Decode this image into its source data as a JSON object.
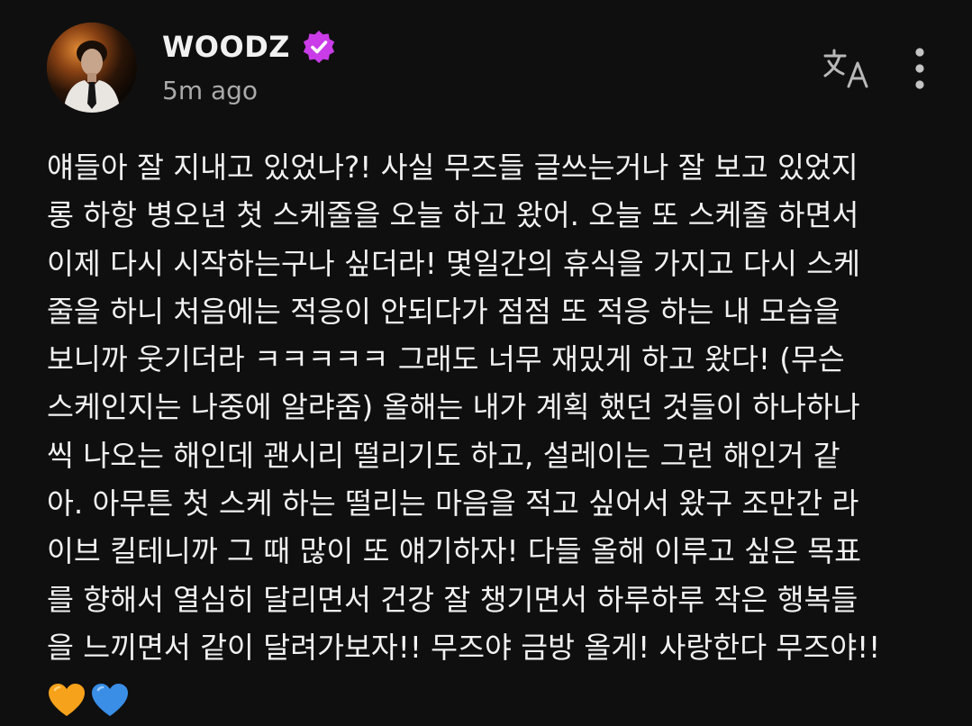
{
  "post": {
    "author": "WOODZ",
    "timestamp": "5m ago",
    "lines": [
      "얘들아 잘 지내고 있었나?! 사실 무즈들 글쓰는거나 잘 보고 있었지",
      "롱 하항 병오년 첫 스케줄을 오늘 하고 왔어. 오늘 또 스케줄 하면서",
      "이제 다시 시작하는구나 싶더라! 몇일간의 휴식을 가지고 다시 스케",
      "줄을 하니 처음에는 적응이 안되다가 점점 또 적응 하는 내 모습을",
      "보니까 웃기더라 ㅋㅋㅋㅋㅋ 그래도 너무 재밌게 하고 왔다! (무슨",
      "스케인지는 나중에 알랴줌) 올해는 내가 계획 했던 것들이 하나하나",
      "씩 나오는 해인데 괜시리 떨리기도 하고, 설레이는 그런 해인거 같",
      "아. 아무튼 첫 스케 하는 떨리는 마음을 적고 싶어서 왔구 조만간 라",
      "이브 킬테니까 그 때 많이 또 얘기하자! 다들 올해 이루고 싶은 목표",
      "를 향해서 열심히 달리면서 건강 잘 챙기면서 하루하루 작은 행복들",
      "을 느끼면서 같이 달려가보자!! 무즈야 금방 올게! 사랑한다 무즈야!!"
    ],
    "emojis": [
      {
        "icon": "orange-heart-icon",
        "color": "#f7a21b"
      },
      {
        "icon": "blue-heart-icon",
        "color": "#3a8ee6"
      }
    ]
  },
  "colors": {
    "background": "#0f0f0f",
    "text": "#f1f1f1",
    "muted": "#aaaaaa",
    "verified": "#c93ce8"
  }
}
